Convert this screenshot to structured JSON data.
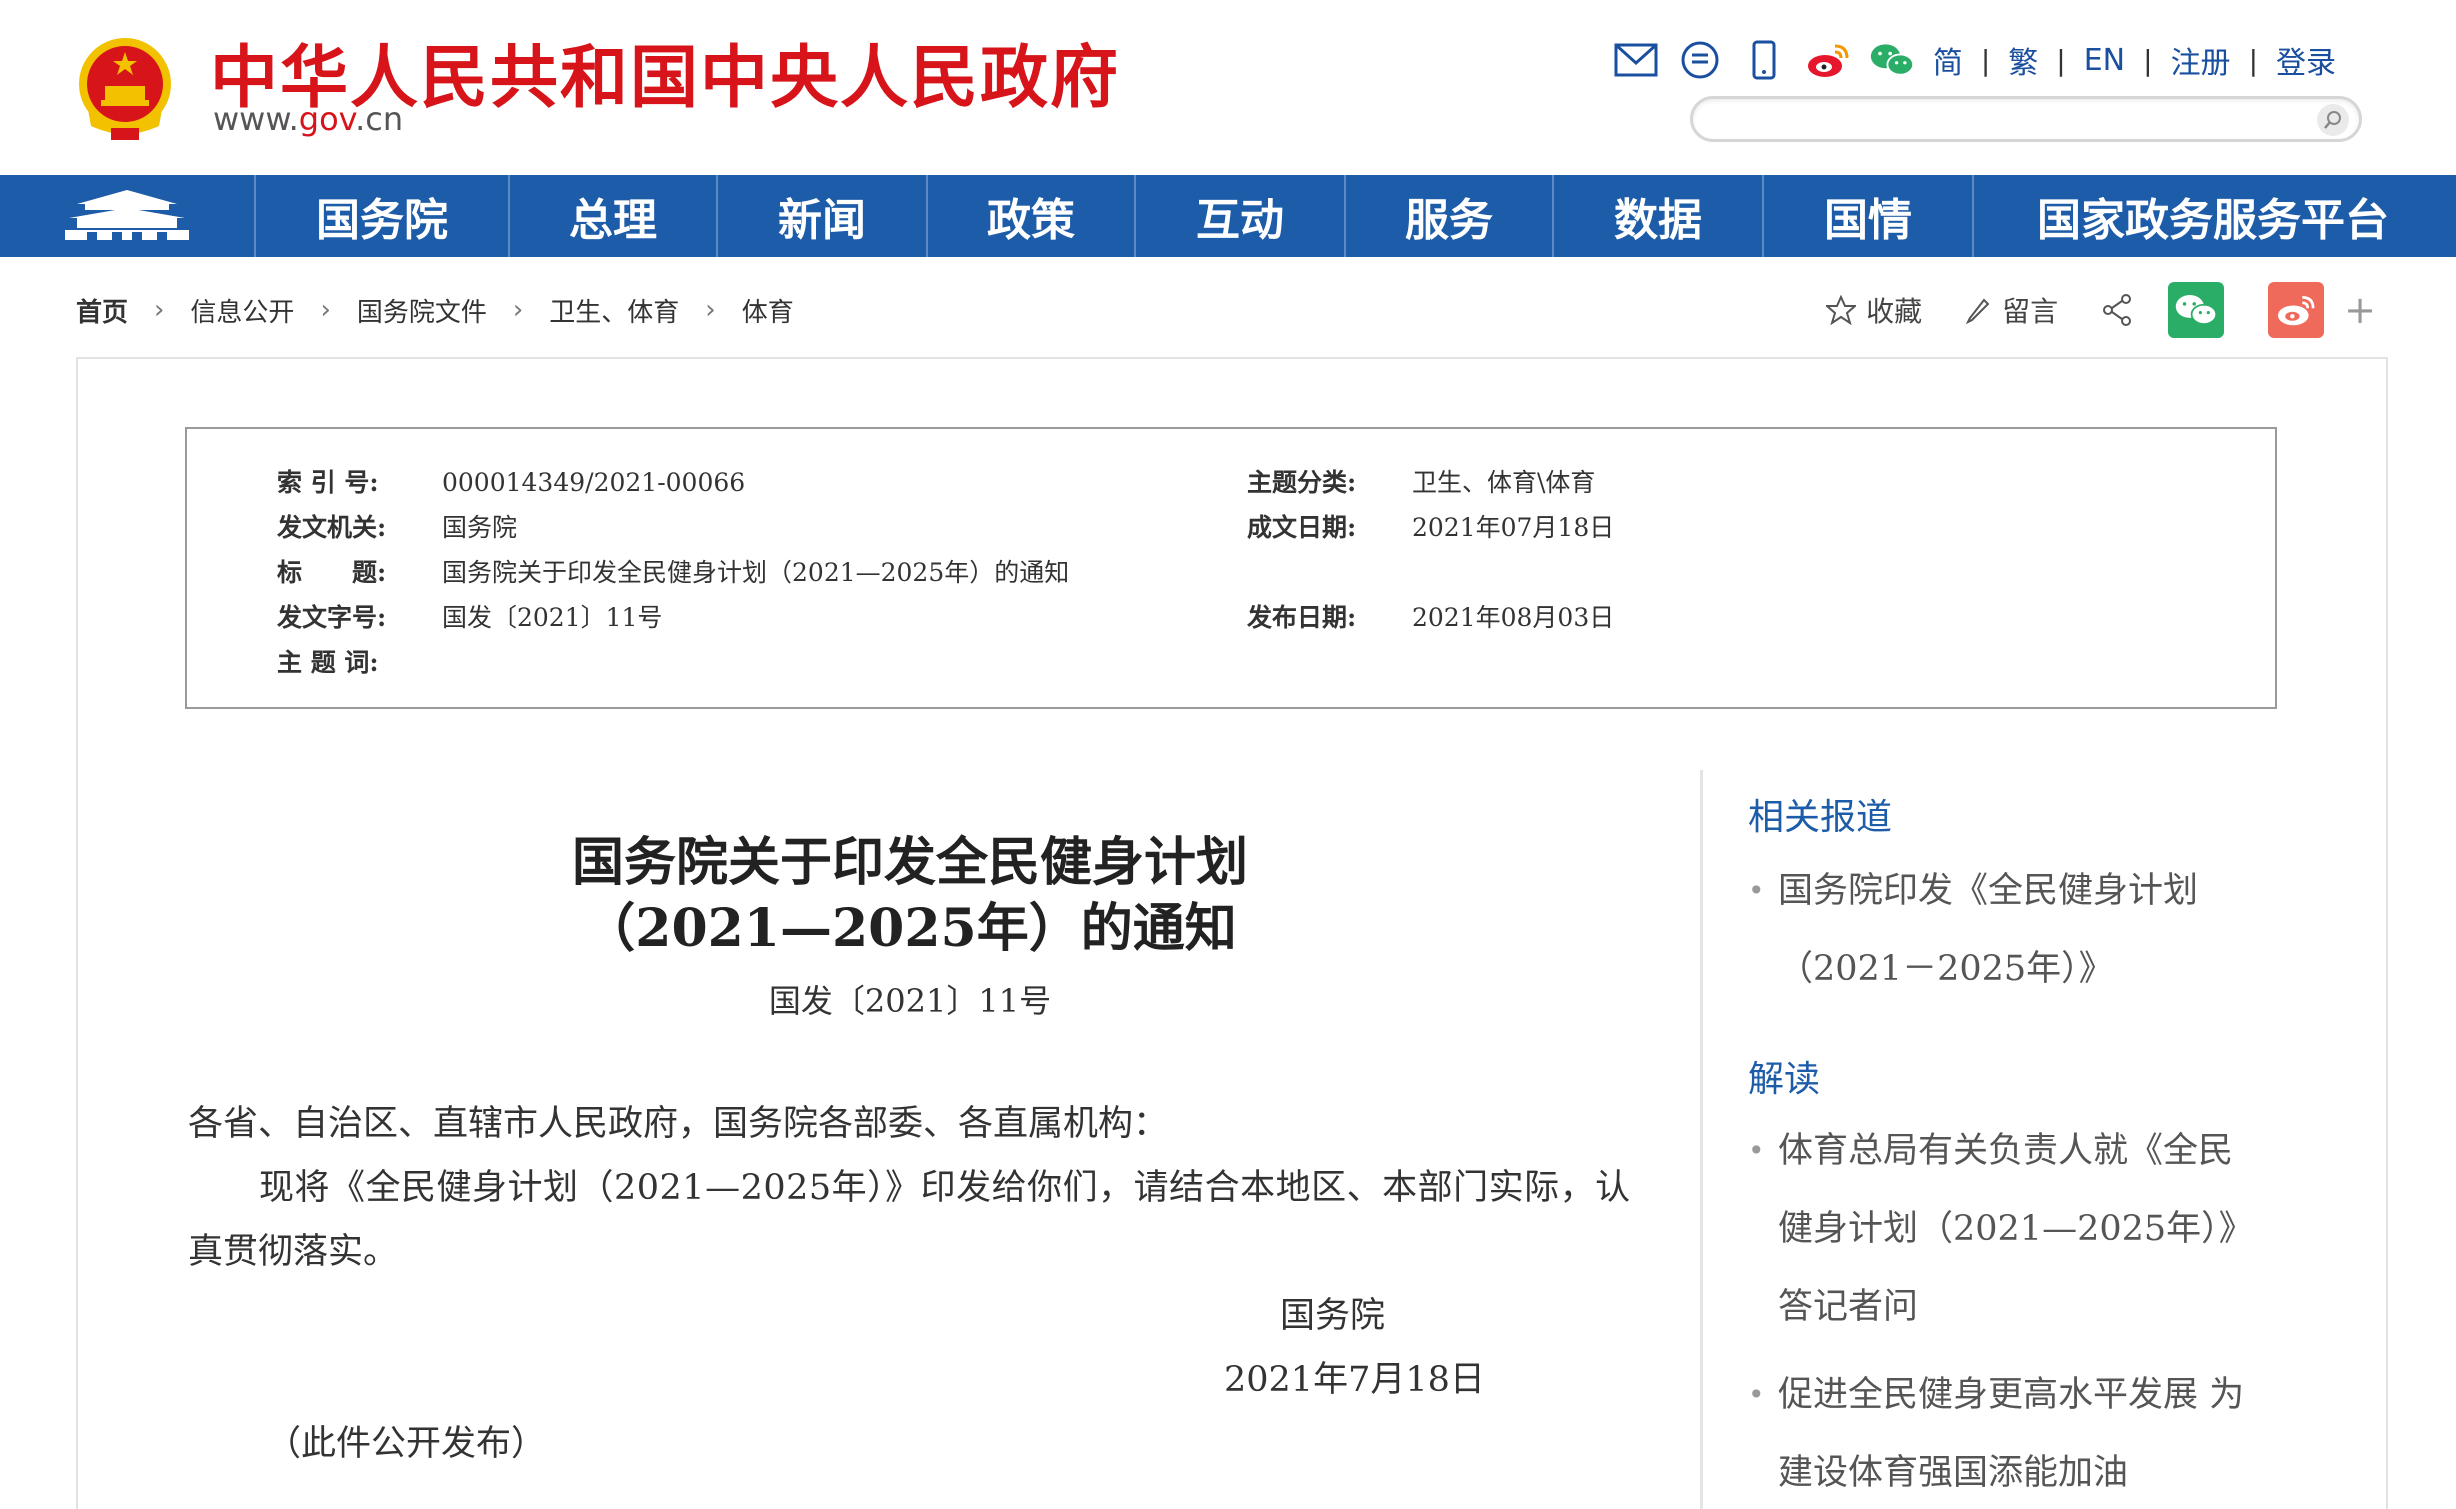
{
  "header": {
    "site_title": "中华人民共和国中央人民政府",
    "site_url_prefix": "www.",
    "site_url_domain": "gov",
    "site_url_suffix": ".cn",
    "lang_links": [
      "简",
      "繁",
      "EN",
      "注册",
      "登录"
    ],
    "top_icons": [
      "mail-icon",
      "message-icon",
      "mobile-icon",
      "weibo-icon",
      "wechat-icon"
    ],
    "search_placeholder": ""
  },
  "nav": {
    "items": [
      "国务院",
      "总理",
      "新闻",
      "政策",
      "互动",
      "服务",
      "数据",
      "国情",
      "国家政务服务平台"
    ]
  },
  "breadcrumb": [
    "首页",
    "信息公开",
    "国务院文件",
    "卫生、体育",
    "体育"
  ],
  "tools": {
    "favorite": "收藏",
    "comment": "留言"
  },
  "info": {
    "index_label": "索 引 号:",
    "index_value": "000014349/2021-00066",
    "issuer_label": "发文机关:",
    "issuer_value": "国务院",
    "title_label": "标　　题:",
    "title_value": "国务院关于印发全民健身计划（2021—2025年）的通知",
    "docno_label": "发文字号:",
    "docno_value": "国发〔2021〕11号",
    "keywords_label": "主 题 词:",
    "keywords_value": "",
    "topic_label": "主题分类:",
    "topic_value": "卫生、体育\\体育",
    "written_label": "成文日期:",
    "written_value": "2021年07月18日",
    "published_label": "发布日期:",
    "published_value": "2021年08月03日"
  },
  "doc": {
    "title_line1": "国务院关于印发全民健身计划",
    "title_line2": "（2021—2025年）的通知",
    "number": "国发〔2021〕11号",
    "salutation": "各省、自治区、直辖市人民政府，国务院各部委、各直属机构：",
    "para1_line1": "　　现将《全民健身计划（2021—2025年）》印发给你们，请结合本地区、本部门实际，认",
    "para1_line2": "真贯彻落实。",
    "signer": "国务院",
    "date": "2021年7月18日",
    "note": "（此件公开发布）"
  },
  "sidebar": {
    "related_head": "相关报道",
    "related_item_line1": "国务院印发《全民健身计划",
    "related_item_line2": "（2021－2025年）》",
    "interp_head": "解读",
    "interp_item1_line1": "体育总局有关负责人就《全民",
    "interp_item1_line2": "健身计划（2021—2025年）》",
    "interp_item1_line3": "答记者问",
    "interp_item2_line1": "促进全民健身更高水平发展 为",
    "interp_item2_line2": "建设体育强国添能加油"
  },
  "colors": {
    "brand_red": "#d7141a",
    "nav_blue": "#1d5ca8",
    "link_blue": "#1a4fa0"
  }
}
